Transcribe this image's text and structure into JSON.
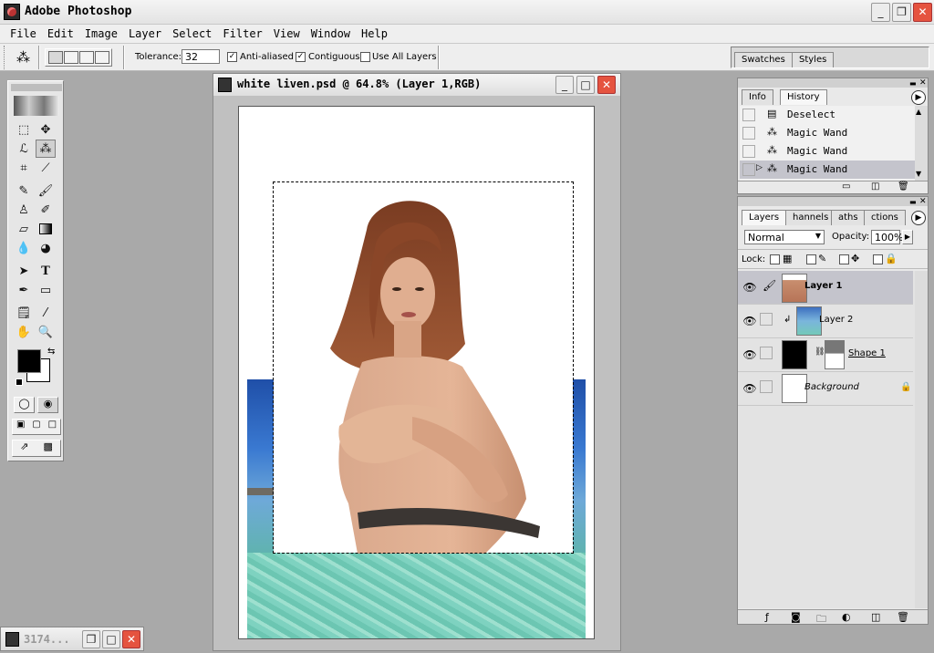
{
  "app": {
    "title": "Adobe Photoshop"
  },
  "menu": [
    "File",
    "Edit",
    "Image",
    "Layer",
    "Select",
    "Filter",
    "View",
    "Window",
    "Help"
  ],
  "options": {
    "tolerance_label": "Tolerance:",
    "tolerance_value": "32",
    "anti_aliased": "Anti-aliased",
    "contiguous": "Contiguous",
    "use_all_layers": "Use All Layers"
  },
  "swatches_panel": {
    "tabs": [
      "Swatches",
      "Styles"
    ]
  },
  "document": {
    "title": "white liven.psd @ 64.8% (Layer 1,RGB)"
  },
  "history_panel": {
    "tabs": [
      "Info",
      "History"
    ],
    "items": [
      "Deselect",
      "Magic Wand",
      "Magic Wand",
      "Magic Wand"
    ]
  },
  "layers_panel": {
    "tabs": [
      "Layers",
      "hannels",
      "aths",
      "ctions"
    ],
    "blend_mode": "Normal",
    "opacity_label": "Opacity:",
    "opacity_value": "100%",
    "lock_label": "Lock:",
    "layers": [
      {
        "name": "Layer 1"
      },
      {
        "name": "Layer 2"
      },
      {
        "name": "Shape 1"
      },
      {
        "name": "Background"
      }
    ]
  },
  "minimized_window": {
    "title": "3174..."
  },
  "colors": {
    "accent_close": "#e5533f",
    "selection_highlight": "#c4c4cc"
  }
}
